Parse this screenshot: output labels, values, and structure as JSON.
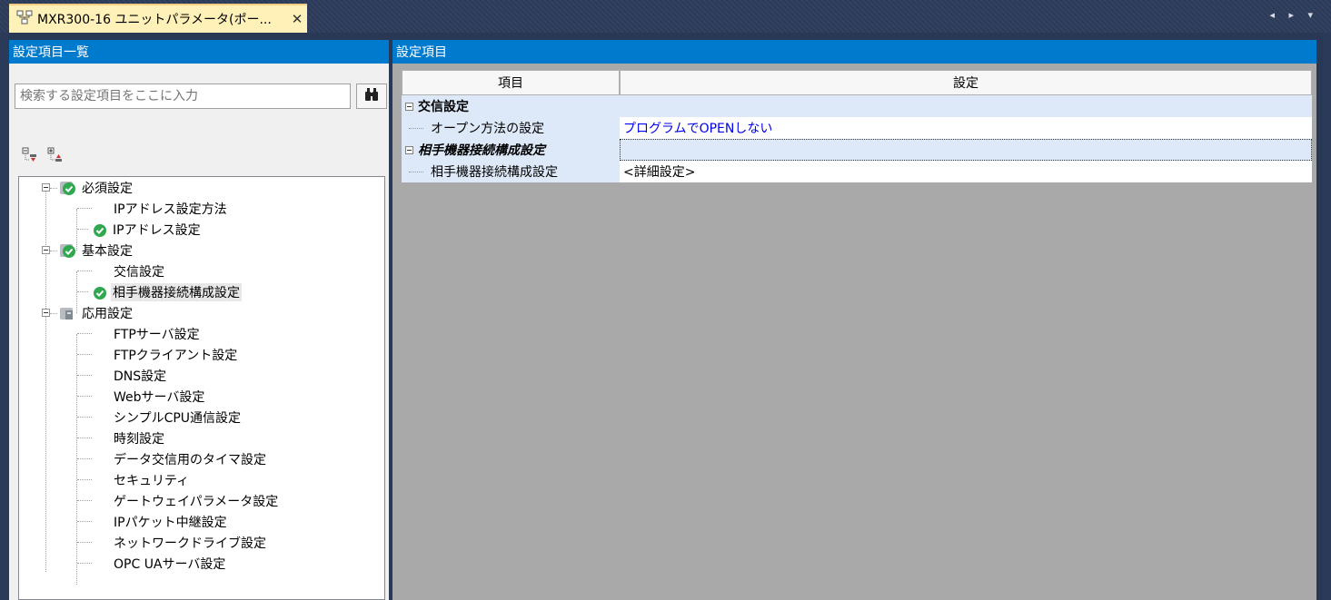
{
  "window": {
    "tab_title": "MXR300-16 ユニットパラメータ(ポー...",
    "close_glyph": "✕",
    "nav_glyph": "◂ ▸ ▾"
  },
  "left_panel": {
    "header": "設定項目一覧",
    "search_placeholder": "検索する設定項目をここに入力",
    "tree": [
      {
        "label": "必須設定",
        "level": 0,
        "status": "ok"
      },
      {
        "label": "IPアドレス設定方法",
        "level": 1,
        "status": "none"
      },
      {
        "label": "IPアドレス設定",
        "level": 1,
        "status": "ok"
      },
      {
        "label": "基本設定",
        "level": 0,
        "status": "ok"
      },
      {
        "label": "交信設定",
        "level": 1,
        "status": "none"
      },
      {
        "label": "相手機器接続構成設定",
        "level": 1,
        "status": "ok",
        "selected": true
      },
      {
        "label": "応用設定",
        "level": 0,
        "status": "folder"
      },
      {
        "label": "FTPサーバ設定",
        "level": 1,
        "status": "none"
      },
      {
        "label": "FTPクライアント設定",
        "level": 1,
        "status": "none"
      },
      {
        "label": "DNS設定",
        "level": 1,
        "status": "none"
      },
      {
        "label": "Webサーバ設定",
        "level": 1,
        "status": "none"
      },
      {
        "label": "シンプルCPU通信設定",
        "level": 1,
        "status": "none"
      },
      {
        "label": "時刻設定",
        "level": 1,
        "status": "none"
      },
      {
        "label": "データ交信用のタイマ設定",
        "level": 1,
        "status": "none"
      },
      {
        "label": "セキュリティ",
        "level": 1,
        "status": "none"
      },
      {
        "label": "ゲートウェイパラメータ設定",
        "level": 1,
        "status": "none"
      },
      {
        "label": "IPパケット中継設定",
        "level": 1,
        "status": "none"
      },
      {
        "label": "ネットワークドライブ設定",
        "level": 1,
        "status": "none"
      },
      {
        "label": "OPC UAサーバ設定",
        "level": 1,
        "status": "none"
      }
    ]
  },
  "right_panel": {
    "header": "設定項目",
    "columns": [
      "項目",
      "設定"
    ],
    "rows": [
      {
        "type": "category",
        "label": "交信設定",
        "italic": false
      },
      {
        "type": "item",
        "label": "オープン方法の設定",
        "value": "プログラムでOPENしない",
        "value_color": "#0000ee"
      },
      {
        "type": "category",
        "label": "相手機器接続構成設定",
        "italic": true
      },
      {
        "type": "item",
        "label": "相手機器接続構成設定",
        "value": "<詳細設定>",
        "value_color": "#000000"
      }
    ]
  },
  "colors": {
    "accent": "#007acc",
    "tab_active": "#fff1b8",
    "ok_check": "#2fa84f",
    "row_highlight": "#dde9f8",
    "grid_background": "#a9a9a9"
  }
}
